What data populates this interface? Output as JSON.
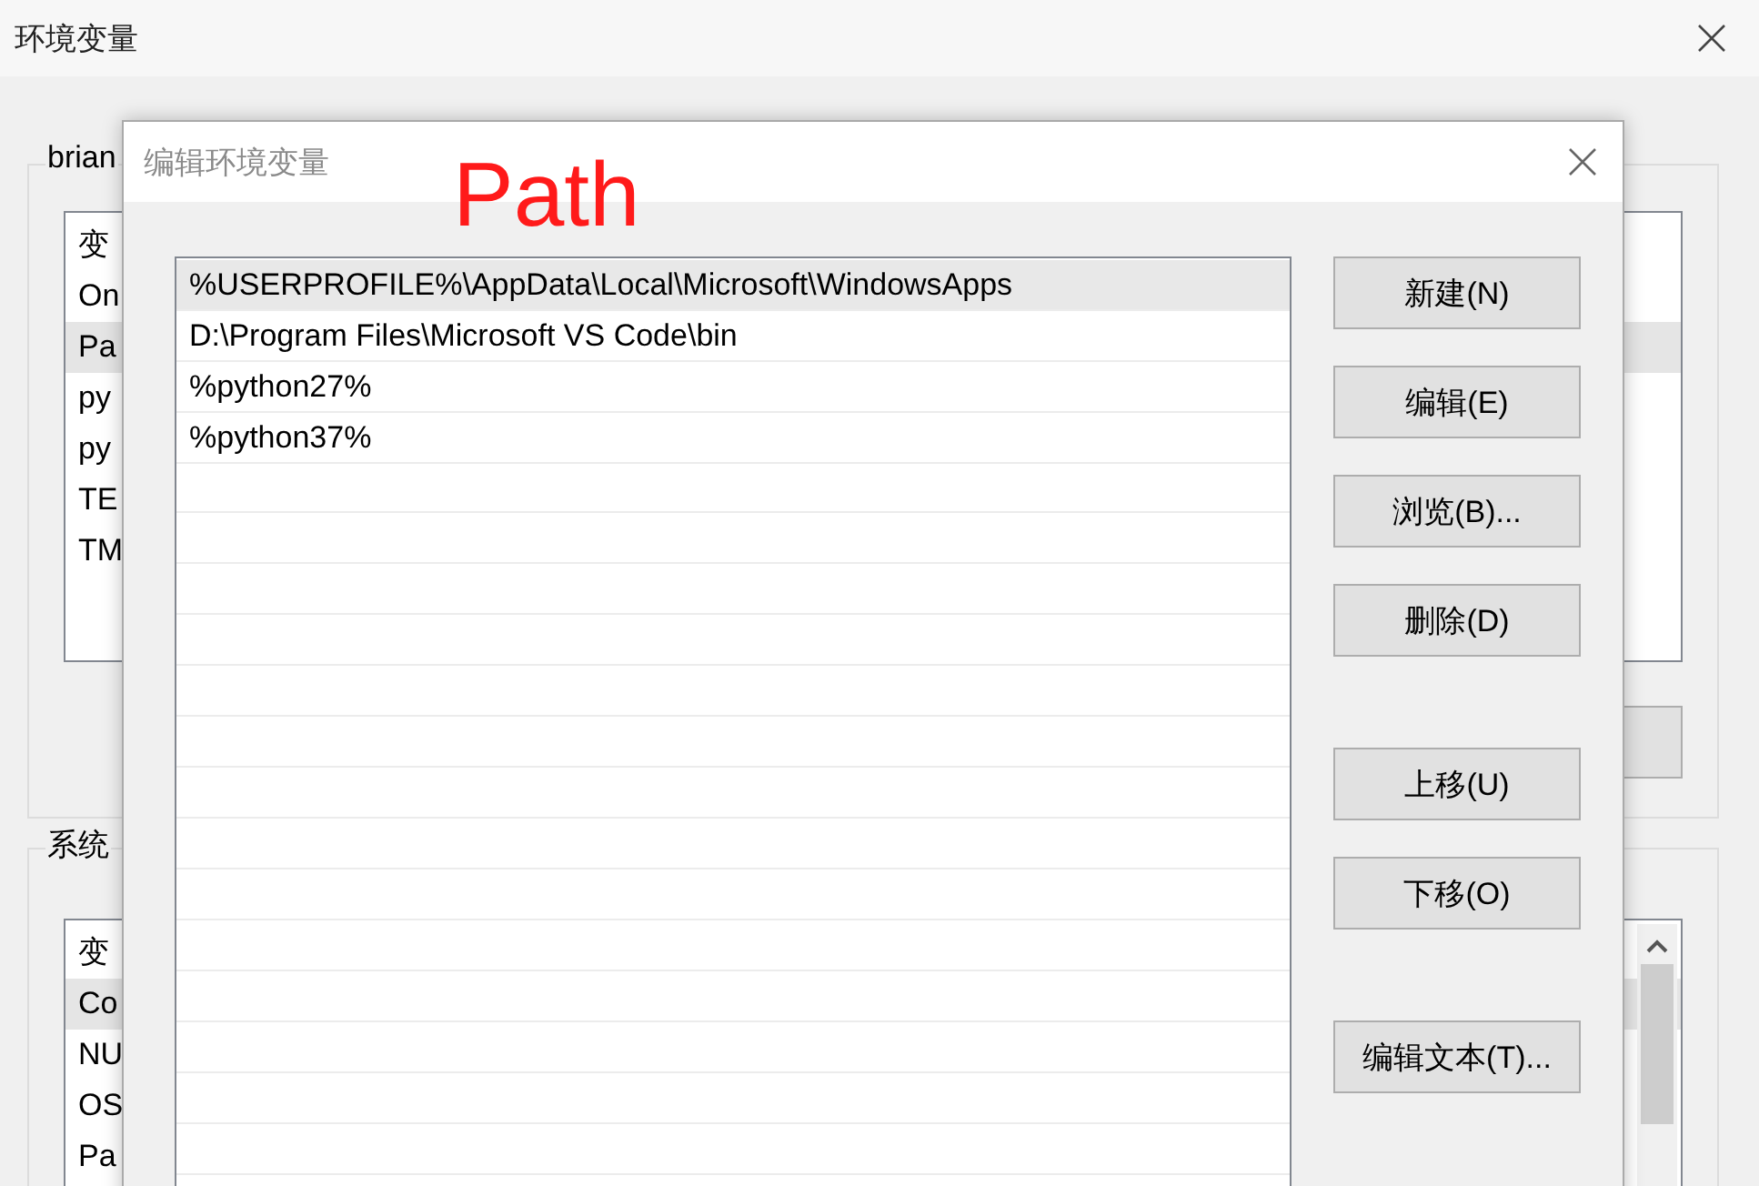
{
  "window": {
    "title": "环境变量"
  },
  "user_variables": {
    "label": "brian",
    "header": "变",
    "items": [
      {
        "name": "On",
        "selected": false
      },
      {
        "name": "Pa",
        "selected": true
      },
      {
        "name": "py",
        "selected": false
      },
      {
        "name": "py",
        "selected": false
      },
      {
        "name": "TE",
        "selected": false
      },
      {
        "name": "TM",
        "selected": false
      }
    ]
  },
  "system_variables": {
    "label": "系统",
    "header": "变",
    "items": [
      {
        "name": "Co",
        "selected": true
      },
      {
        "name": "NU",
        "selected": false
      },
      {
        "name": "OS",
        "selected": false
      },
      {
        "name": "Pa",
        "selected": false
      }
    ]
  },
  "dialog": {
    "title": "编辑环境变量",
    "annotation": "Path",
    "entries": [
      {
        "text": "%USERPROFILE%\\AppData\\Local\\Microsoft\\WindowsApps",
        "selected": true
      },
      {
        "text": "D:\\Program Files\\Microsoft VS Code\\bin",
        "selected": false
      },
      {
        "text": "%python27%",
        "selected": false
      },
      {
        "text": "%python37%",
        "selected": false
      }
    ],
    "button_groups": [
      [
        "新建(N)",
        "编辑(E)",
        "浏览(B)...",
        "删除(D)"
      ],
      [
        "上移(U)",
        "下移(O)"
      ],
      [
        "编辑文本(T)..."
      ]
    ]
  }
}
